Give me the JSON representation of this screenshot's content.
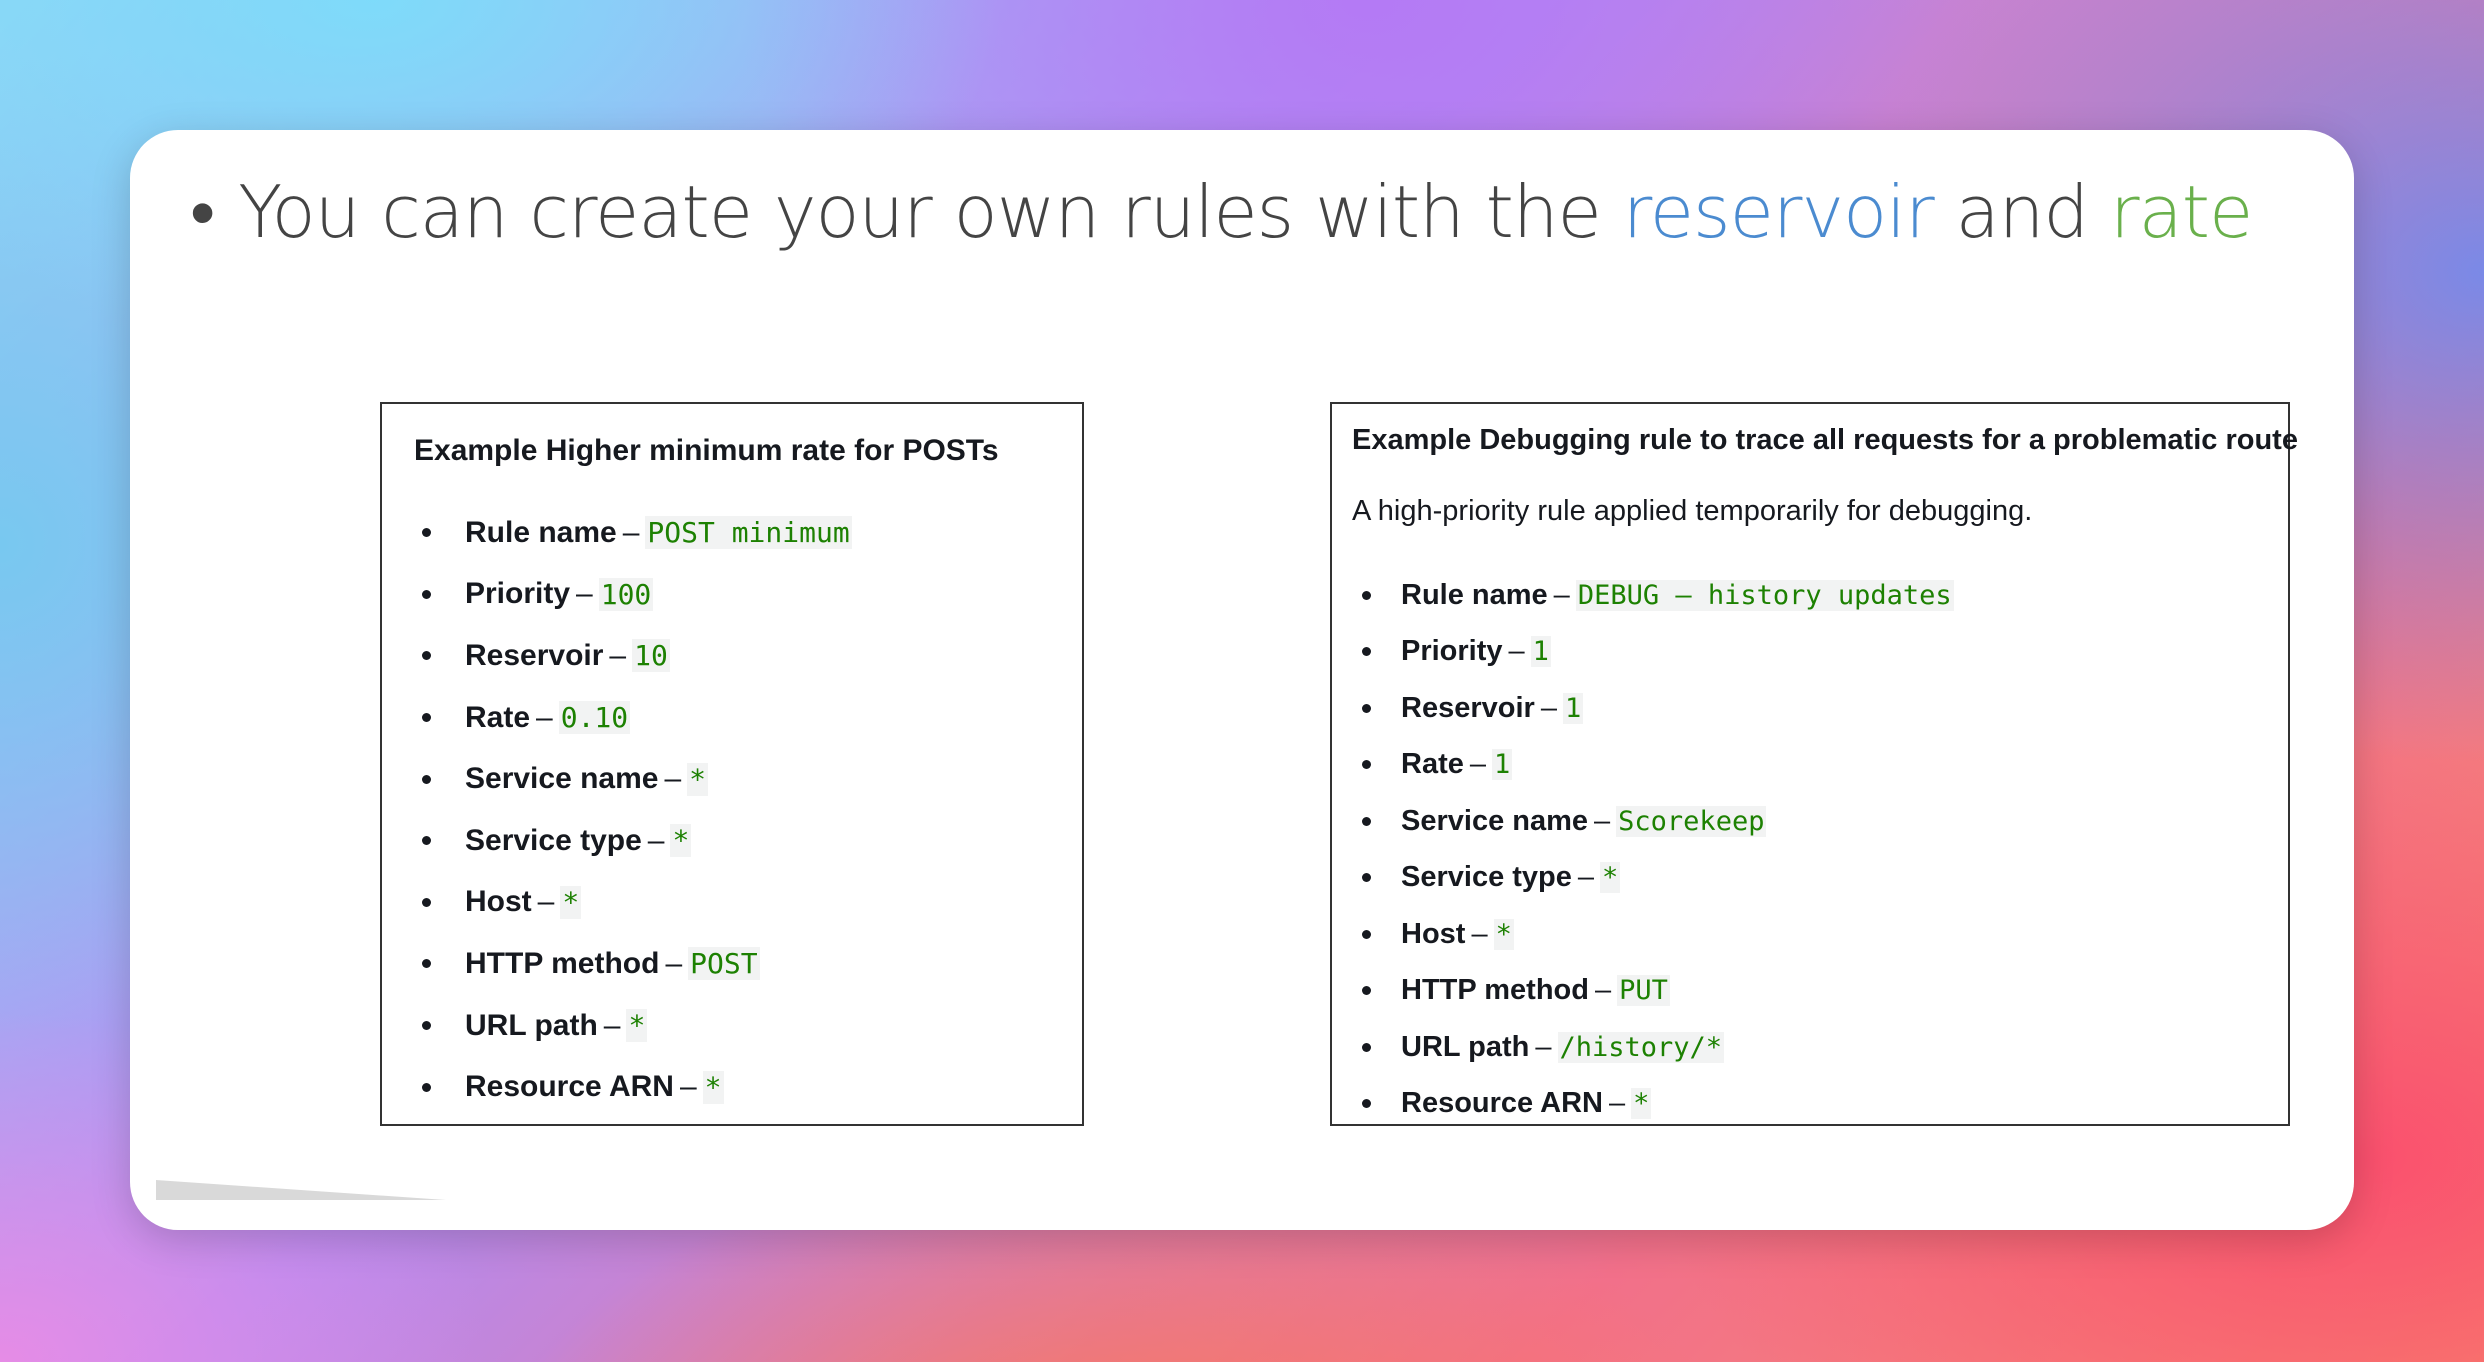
{
  "headline": {
    "bullet": "•",
    "text_before": "You can create your own rules with the",
    "keyword_reservoir": "reservoir",
    "text_and": "and",
    "keyword_rate": "rate"
  },
  "left_example": {
    "title": "Example Higher minimum rate for POSTs",
    "rules": [
      {
        "label": "Rule name",
        "value": "POST minimum"
      },
      {
        "label": "Priority",
        "value": "100"
      },
      {
        "label": "Reservoir",
        "value": "10"
      },
      {
        "label": "Rate",
        "value": "0.10"
      },
      {
        "label": "Service name",
        "value": "*"
      },
      {
        "label": "Service type",
        "value": "*"
      },
      {
        "label": "Host",
        "value": "*"
      },
      {
        "label": "HTTP method",
        "value": "POST"
      },
      {
        "label": "URL path",
        "value": "*"
      },
      {
        "label": "Resource ARN",
        "value": "*"
      }
    ]
  },
  "right_example": {
    "title": "Example Debugging rule to trace all requests for a problematic route",
    "description": "A high-priority rule applied temporarily for debugging.",
    "rules": [
      {
        "label": "Rule name",
        "value": "DEBUG – history updates"
      },
      {
        "label": "Priority",
        "value": "1"
      },
      {
        "label": "Reservoir",
        "value": "1"
      },
      {
        "label": "Rate",
        "value": "1"
      },
      {
        "label": "Service name",
        "value": "Scorekeep"
      },
      {
        "label": "Service type",
        "value": "*"
      },
      {
        "label": "Host",
        "value": "*"
      },
      {
        "label": "HTTP method",
        "value": "PUT"
      },
      {
        "label": "URL path",
        "value": "/history/*"
      },
      {
        "label": "Resource ARN",
        "value": "*"
      }
    ]
  },
  "separator": "–",
  "colors": {
    "reservoir": "#4b8bd0",
    "rate": "#6ab04c",
    "code_value": "#1d8102"
  }
}
